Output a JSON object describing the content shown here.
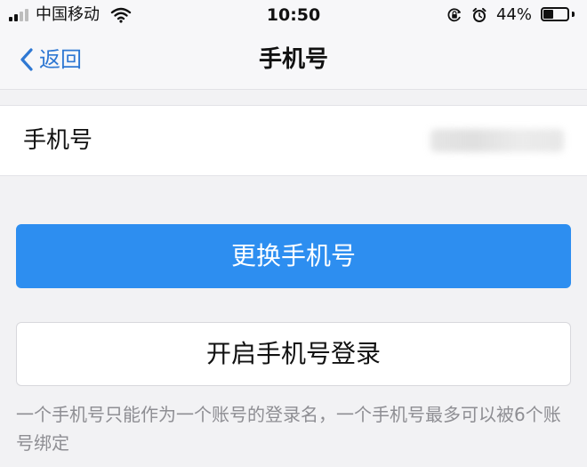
{
  "status_bar": {
    "carrier": "中国移动",
    "time": "10:50",
    "battery_text": "44%",
    "battery_level": 0.44,
    "icons": [
      "signal-icon",
      "wifi-icon",
      "orientation-lock-icon",
      "alarm-icon",
      "battery-icon"
    ]
  },
  "nav": {
    "back_label": "返回",
    "title": "手机号"
  },
  "phone_row": {
    "label": "手机号",
    "value_state": "blurred"
  },
  "actions": {
    "change_phone": "更换手机号",
    "enable_phone_login": "开启手机号登录"
  },
  "note": "一个手机号只能作为一个账号的登录名，一个手机号最多可以被6个账号绑定",
  "colors": {
    "accent": "#2f78d3",
    "primary_button": "#2d8ef0",
    "background": "#f2f2f4",
    "secondary_text": "#8e8e93"
  }
}
